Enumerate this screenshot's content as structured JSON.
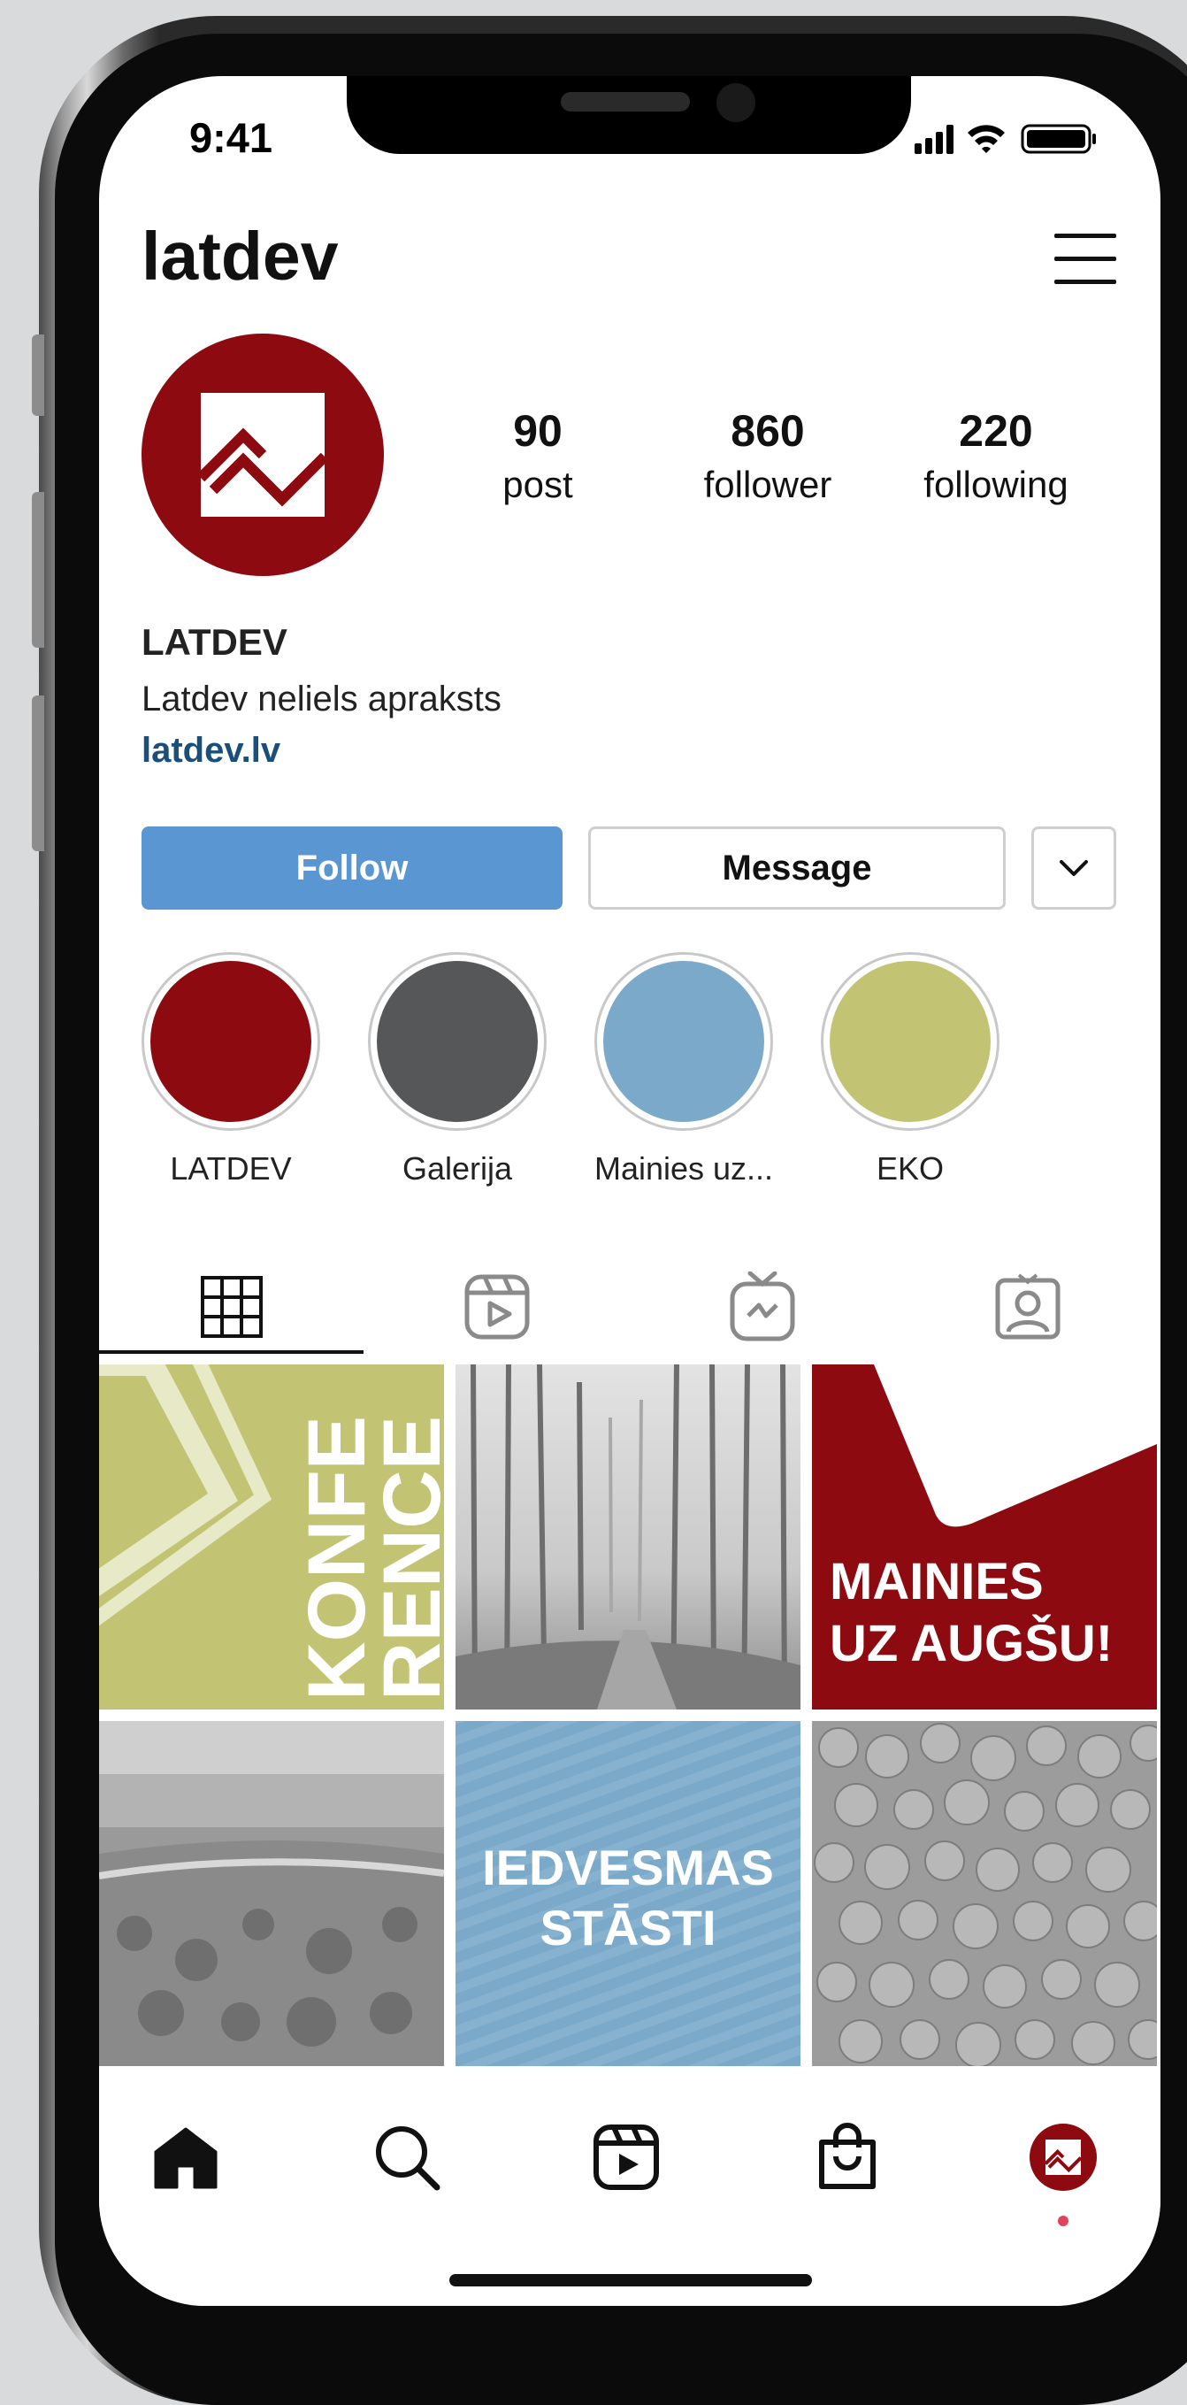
{
  "status_bar": {
    "time": "9:41"
  },
  "header": {
    "username": "latdev"
  },
  "profile": {
    "stats": [
      {
        "value": "90",
        "label": "post"
      },
      {
        "value": "860",
        "label": "follower"
      },
      {
        "value": "220",
        "label": "following"
      }
    ],
    "display_name": "LATDEV",
    "bio": "Latdev neliels apraksts",
    "website": "latdev.lv"
  },
  "actions": {
    "follow": "Follow",
    "message": "Message"
  },
  "highlights": [
    {
      "label": "LATDEV",
      "color": "#8c0a10"
    },
    {
      "label": "Galerija",
      "color": "#555759"
    },
    {
      "label": "Mainies uz...",
      "color": "#7aa9c9"
    },
    {
      "label": "EKO",
      "color": "#c2c474"
    }
  ],
  "tabs": [
    "grid-icon",
    "reels-icon",
    "igtv-icon",
    "tagged-icon"
  ],
  "posts": {
    "p1": {
      "lines": [
        "KONFE",
        "RENCE"
      ]
    },
    "p3": {
      "lines": [
        "MAINIES",
        "UZ AUGŠU!"
      ]
    },
    "p5": {
      "lines": [
        "IEDVESMAS",
        "STĀSTI"
      ]
    }
  },
  "bottom_nav": [
    "home-icon",
    "search-icon",
    "reels-icon",
    "shop-icon",
    "profile-avatar"
  ],
  "colors": {
    "brand_red": "#8c0a10",
    "follow_blue": "#5a96d1",
    "link_blue": "#1a4f7a",
    "olive": "#c2c474",
    "sky": "#7aa9c9"
  }
}
